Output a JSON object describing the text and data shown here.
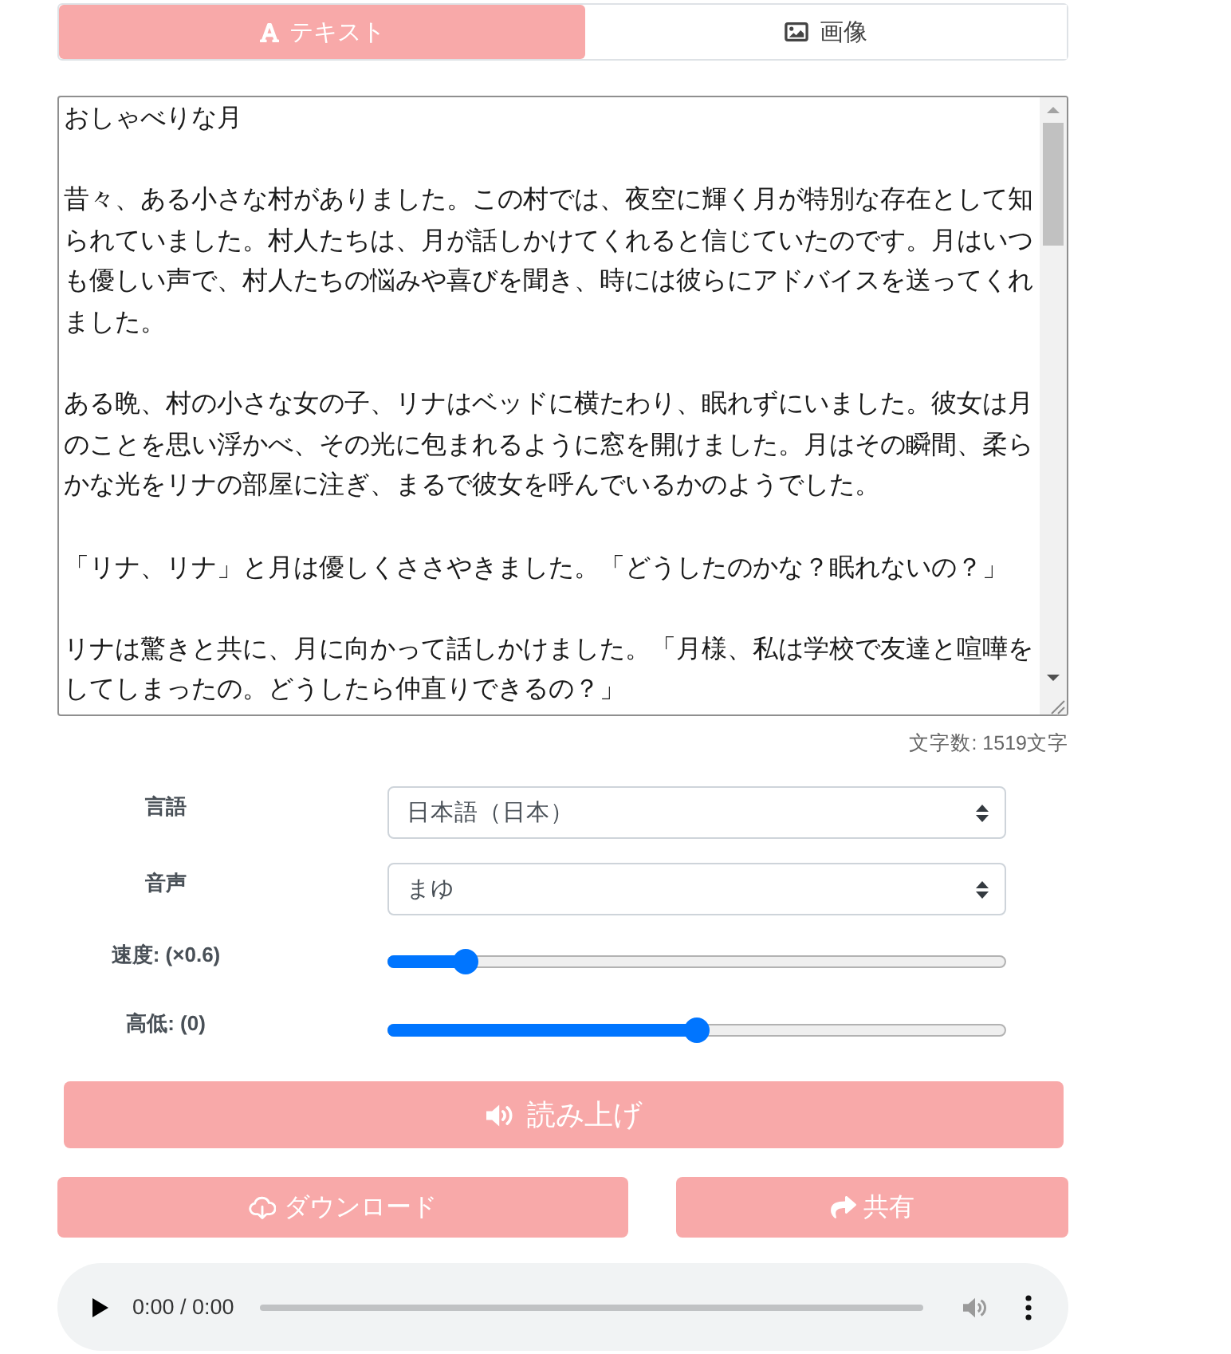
{
  "tabs": [
    {
      "kind": "text",
      "label": "テキスト",
      "selected": true
    },
    {
      "kind": "image",
      "label": "画像",
      "selected": false
    }
  ],
  "text_area": {
    "paragraphs": [
      "おしゃべりな月",
      "昔々、ある小さな村がありました。この村では、夜空に輝く月が特別な存在として知られていました。村人たちは、月が話しかけてくれると信じていたのです。月はいつも優しい声で、村人たちの悩みや喜びを聞き、時には彼らにアドバイスを送ってくれました。",
      "ある晩、村の小さな女の子、リナはベッドに横たわり、眠れずにいました。彼女は月のことを思い浮かべ、その光に包まれるように窓を開けました。月はその瞬間、柔らかな光をリナの部屋に注ぎ、まるで彼女を呼んでいるかのようでした。",
      "「リナ、リナ」と月は優しくささやきました。「どうしたのかな？眠れないの？」",
      "リナは驚きと共に、月に向かって話しかけました。「月様、私は学校で友達と喧嘩をしてしまったの。どうしたら仲直りできるの？」"
    ]
  },
  "char_count": "文字数: 1519文字",
  "settings": [
    {
      "kind": "select",
      "label": "言語",
      "value": "日本語（日本）"
    },
    {
      "kind": "select",
      "label": "音声",
      "value": "まゆ"
    },
    {
      "kind": "slider",
      "label": "速度: (×0.6)",
      "level": 0.11
    },
    {
      "kind": "slider",
      "label": "高低: (0)",
      "level": 0.5
    }
  ],
  "read_button": {
    "label": "読み上げ"
  },
  "action_buttons": [
    {
      "kind": "download",
      "label": "ダウンロード"
    },
    {
      "kind": "share",
      "label": "共有"
    }
  ],
  "audio_player": {
    "time": "0:00 / 0:00"
  }
}
